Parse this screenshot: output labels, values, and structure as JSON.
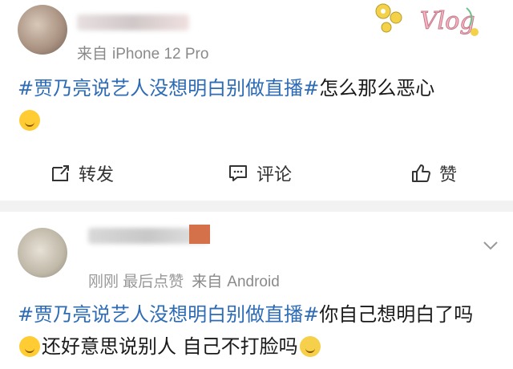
{
  "posts": [
    {
      "source_prefix": "来自",
      "source": "iPhone 12 Pro",
      "hashtag": "#贾乃亮说艺人没想明白别做直播#",
      "text": "怎么那么恶心",
      "emoji": "thinking-emoji"
    },
    {
      "time": "刚刚 最后点赞",
      "source_prefix": "来自",
      "source": "Android",
      "hashtag": "#贾乃亮说艺人没想明白别做直播#",
      "text": "你自己想明白了吗",
      "text2": "还好意思说别人 自己不打脸吗",
      "emoji1": "laughing-emoji",
      "emoji2": "sweat-emoji"
    }
  ],
  "actions": {
    "repost_label": "转发",
    "comment_label": "评论",
    "like_label": "赞"
  },
  "sticker_text": "Vlog",
  "colors": {
    "hashtag": "#2d6bb5",
    "meta": "#8a8a8a",
    "divider": "#f2f2f2"
  }
}
